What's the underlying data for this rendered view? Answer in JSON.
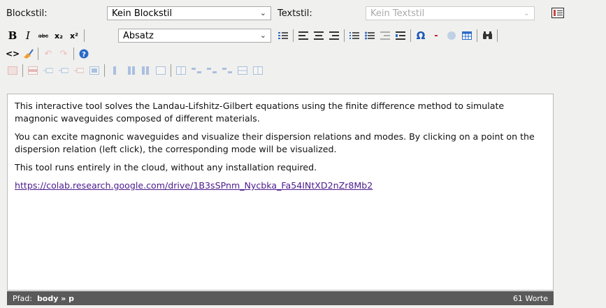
{
  "toolbar": {
    "blockstil_label": "Blockstil:",
    "blockstil_value": "Kein Blockstil",
    "textstil_label": "Textstil:",
    "textstil_value": "Kein Textstil",
    "format_value": "Absatz",
    "bold_label": "B",
    "italic_label": "I",
    "strike_label": "abc",
    "subscript_label": "x₂",
    "superscript_label": "x²",
    "omega_label": "Ω",
    "hr_label": "-"
  },
  "content": {
    "paragraphs": [
      "This interactive tool solves the Landau-Lifshitz-Gilbert equations using the finite difference method to simulate magnonic waveguides composed of different materials.",
      "You can excite magnonic waveguides and visualize their dispersion relations and modes. By clicking on a point on the dispersion relation (left click), the corresponding mode will be visualized.",
      "This tool runs entirely in the cloud, without any installation required."
    ],
    "link": "https://colab.research.google.com/drive/1B3sSPnm_Nycbka_Fa54INtXD2nZr8Mb2"
  },
  "status": {
    "path_label": "Pfad:",
    "path_value": "body » p",
    "word_count": "61 Worte"
  },
  "icons": {
    "side": "toggle-editor-icon",
    "code": "source-code-icon",
    "cleanup": "cleanup-broom-icon",
    "undo": "undo-icon",
    "redo": "redo-icon",
    "help": "help-icon",
    "search": "binoculars-icon",
    "table": "table-icon",
    "image": "image-icon"
  },
  "colors": {
    "link": "#4b1a8c",
    "status_bar": "#5a5a5a",
    "omega": "#1a56b8",
    "hr": "#c0143c"
  }
}
